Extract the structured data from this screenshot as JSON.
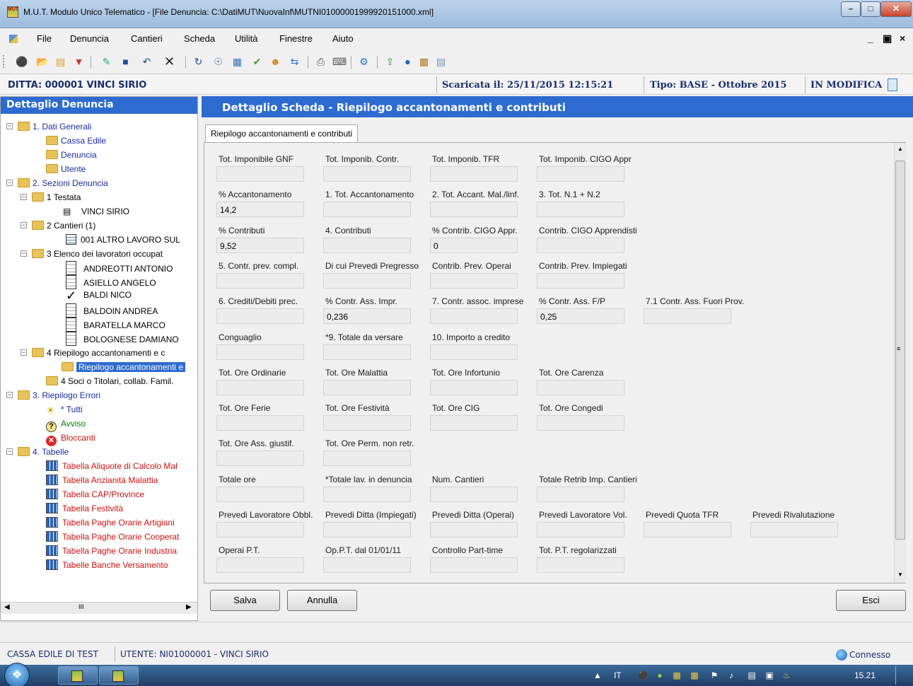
{
  "window": {
    "title": "M.U.T. Modulo Unico Telematico - [File Denuncia: C:\\DatiMUT\\NuovaInf\\MUTNI01000001999920151000.xml]",
    "app_icon_text": "MUT"
  },
  "menu": {
    "items": [
      "File",
      "Denuncia",
      "Cantieri",
      "Scheda",
      "Utilità",
      "Finestre",
      "Aiuto"
    ],
    "mdi_min": "_",
    "mdi_restore": " ",
    "mdi_close": "×"
  },
  "header": {
    "ditta": "DITTA: 000001 VINCI SIRIO",
    "scaricata": "Scaricata il: 25/11/2015 12:15:21",
    "tipo": "Tipo: BASE - Ottobre 2015",
    "stato": "IN MODIFICA"
  },
  "left_panel": {
    "title": "Dettaglio Denuncia",
    "tree": {
      "n1": "1. Dati Generali",
      "n1_a": "Cassa Edile",
      "n1_b": "Denuncia",
      "n1_c": "Utente",
      "n2": "2. Sezioni Denuncia",
      "n2_1": "1 Testata",
      "n2_1_a": "VINCI SIRIO",
      "n2_2": "2 Cantieri (1)",
      "n2_2_a": "001 ALTRO LAVORO SUL",
      "n2_3": "3 Elenco dei lavoratori occupat",
      "w1": "ANDREOTTI ANTONIO",
      "w2": "ASIELLO ANGELO",
      "w3": "BALDI NICO",
      "w4": "BALDOIN ANDREA",
      "w5": "BARATELLA MARCO",
      "w6": "BOLOGNESE DAMIANO",
      "n2_4": "4 Riepilogo accantonamenti e c",
      "n2_4_a": "Riepilogo accantonamenti e",
      "n2_5": "4 Soci o Titolari, collab. Famil.",
      "n3": "3. Riepilogo Errori",
      "n3_a": "* Tutti",
      "n3_b": "Avviso",
      "n3_c": "Bloccanti",
      "n4": "4. Tabelle",
      "t1": "Tabella Aliquote di Calcolo Mal",
      "t2": "Tabella Anzianità Malattia",
      "t3": "Tabella CAP/Province",
      "t4": "Tabella Festività",
      "t5": "Tabella Paghe Orarie Artigiani",
      "t6": "Tabella Paghe Orarie Cooperat",
      "t7": "Tabella Paghe Orarie Industria",
      "t8": "Tabelle Banche Versamento"
    },
    "hscroll_grip": "III"
  },
  "right_panel": {
    "title": "Dettaglio Scheda - Riepilogo accantonamenti e contributi",
    "tab": "Riepilogo accantonamenti e contributi",
    "fields": {
      "r1c1": {
        "label": "Tot. Imponibile GNF",
        "value": ""
      },
      "r1c2": {
        "label": "Tot. Imponib. Contr.",
        "value": ""
      },
      "r1c3": {
        "label": "Tot. Imponib. TFR",
        "value": ""
      },
      "r1c4": {
        "label": "Tot. Imponib. CIGO Appr",
        "value": ""
      },
      "r2c1": {
        "label": "% Accantonamento",
        "value": "14,2"
      },
      "r2c2": {
        "label": "1. Tot. Accantonamento",
        "value": ""
      },
      "r2c3": {
        "label": "2. Tot. Accant. Mal./linf.",
        "value": ""
      },
      "r2c4": {
        "label": "3. Tot. N.1 + N.2",
        "value": ""
      },
      "r3c1": {
        "label": "% Contributi",
        "value": "9,52"
      },
      "r3c2": {
        "label": "4. Contributi",
        "value": ""
      },
      "r3c3": {
        "label": "% Contrib. CIGO Appr.",
        "value": "0"
      },
      "r3c4": {
        "label": "Contrib. CIGO Apprendisti",
        "value": ""
      },
      "r4c1": {
        "label": "5. Contr. prev. compl.",
        "value": ""
      },
      "r4c2": {
        "label": "Di cui Prevedi Pregresso",
        "value": ""
      },
      "r4c3": {
        "label": "Contrib. Prev. Operai",
        "value": ""
      },
      "r4c4": {
        "label": "Contrib. Prev. Impiegati",
        "value": ""
      },
      "r5c1": {
        "label": "6. Crediti/Debiti prec.",
        "value": ""
      },
      "r5c2": {
        "label": "% Contr. Ass. Impr.",
        "value": "0,236"
      },
      "r5c3": {
        "label": "7. Contr. assoc. imprese",
        "value": ""
      },
      "r5c4": {
        "label": "% Contr. Ass. F/P",
        "value": "0,25"
      },
      "r5c5": {
        "label": "7.1 Contr. Ass. Fuori Prov.",
        "value": ""
      },
      "r6c1": {
        "label": "Conguaglio",
        "value": ""
      },
      "r6c2": {
        "label": "*9. Totale da versare",
        "value": ""
      },
      "r6c3": {
        "label": "10. Importo a credito",
        "value": ""
      },
      "r7c1": {
        "label": "Tot. Ore Ordinarie",
        "value": ""
      },
      "r7c2": {
        "label": "Tot. Ore Malattia",
        "value": ""
      },
      "r7c3": {
        "label": "Tot. Ore Infortunio",
        "value": ""
      },
      "r7c4": {
        "label": "Tot. Ore Carenza",
        "value": ""
      },
      "r8c1": {
        "label": "Tot. Ore Ferie",
        "value": ""
      },
      "r8c2": {
        "label": "Tot. Ore Festività",
        "value": ""
      },
      "r8c3": {
        "label": "Tot. Ore CIG",
        "value": ""
      },
      "r8c4": {
        "label": "Tot. Ore Congedi",
        "value": ""
      },
      "r9c1": {
        "label": "Tot. Ore Ass. giustif.",
        "value": ""
      },
      "r9c2": {
        "label": "Tot. Ore Perm. non retr.",
        "value": ""
      },
      "r10c1": {
        "label": "Totale ore",
        "value": ""
      },
      "r10c2": {
        "label": "*Totale lav. in denuncia",
        "value": ""
      },
      "r10c3": {
        "label": "Num. Cantieri",
        "value": ""
      },
      "r10c4": {
        "label": "Totale Retrib Imp. Cantieri",
        "value": ""
      },
      "r11c1": {
        "label": "Prevedi Lavoratore Obbl.",
        "value": ""
      },
      "r11c2": {
        "label": "Prevedi Ditta (Impiegati)",
        "value": ""
      },
      "r11c3": {
        "label": "Prevedi Ditta (Operai)",
        "value": ""
      },
      "r11c4": {
        "label": "Prevedi Lavoratore Vol.",
        "value": ""
      },
      "r11c5": {
        "label": "Prevedi Quota TFR",
        "value": ""
      },
      "r11c6": {
        "label": "Prevedi Rivalutazione",
        "value": ""
      },
      "r12c1": {
        "label": "Operai P.T.",
        "value": ""
      },
      "r12c2": {
        "label": "Op.P.T. dal 01/01/11",
        "value": ""
      },
      "r12c3": {
        "label": "Controllo Part-time",
        "value": ""
      },
      "r12c4": {
        "label": "Tot. P.T. regolarizzati",
        "value": ""
      }
    },
    "buttons": {
      "salva": "Salva",
      "annulla": "Annulla",
      "esci": "Esci"
    }
  },
  "statusbar": {
    "cassa": "CASSA EDILE DI TEST",
    "utente": "UTENTE: NI01000001 - VINCI SIRIO",
    "connessione": "Connesso"
  },
  "taskbar": {
    "lang": "IT",
    "clock": "15.21"
  }
}
